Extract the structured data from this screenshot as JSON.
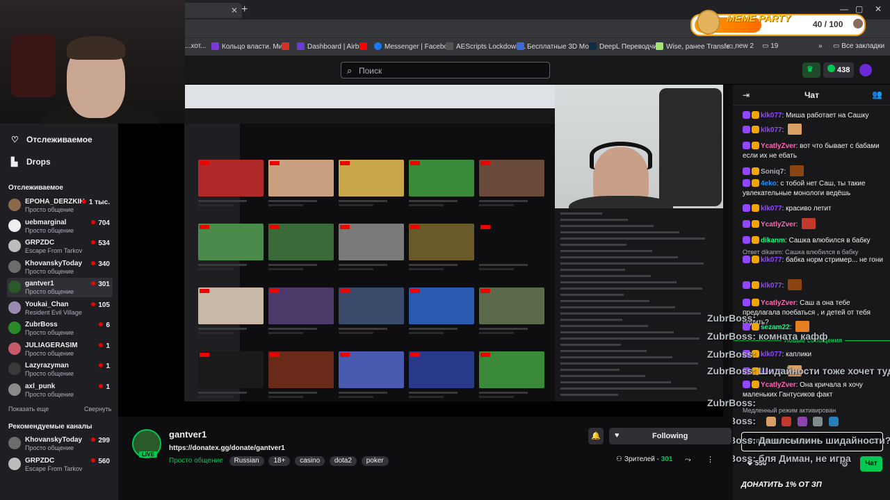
{
  "browser": {
    "tabs": [
      {
        "label": "...",
        "active": true
      }
    ],
    "bookmarks": [
      {
        "label": "...хот..."
      },
      {
        "label": "Кольцо власти. Ми..."
      },
      {
        "label": "Dashboard | Airbit"
      },
      {
        "label": "Messenger | Facebo..."
      },
      {
        "label": "AEScripts Lockdown..."
      },
      {
        "label": "Бесплатные 3D Мо..."
      },
      {
        "label": "DeepL Переводчик"
      },
      {
        "label": "Wise, ранее Transfe..."
      },
      {
        "label": "new 2"
      },
      {
        "label": "19"
      },
      {
        "label": "Все закладки"
      }
    ]
  },
  "overlay": {
    "title": "MEME PARTY",
    "count": "40 / 100"
  },
  "topnav": {
    "search_placeholder": "Поиск",
    "points": "438"
  },
  "sidebar": {
    "nav": [
      {
        "label": "Отслеживаемое",
        "icon": "heart-icon"
      },
      {
        "label": "Drops",
        "icon": "drops-icon"
      }
    ],
    "followed_title": "Отслеживаемое",
    "followed": [
      {
        "name": "EPOHA_DERZKIH",
        "game": "Просто общение",
        "viewers": "1 тыс.",
        "color": "#8a6a4a"
      },
      {
        "name": "uebmarginal",
        "game": "Просто общение",
        "viewers": "704",
        "color": "#eeeeee"
      },
      {
        "name": "GRPZDC",
        "game": "Escape From Tarkov",
        "viewers": "534",
        "color": "#bcbcbc"
      },
      {
        "name": "KhovanskyToday",
        "game": "Просто общение",
        "viewers": "340",
        "color": "#6c6c6c"
      },
      {
        "name": "gantver1",
        "game": "Просто общение",
        "viewers": "301",
        "color": "#2a5a2a"
      },
      {
        "name": "Youkai_Chan",
        "game": "Resident Evil Village",
        "viewers": "105",
        "color": "#9a8ab0"
      },
      {
        "name": "ZubrBoss",
        "game": "Просто общение",
        "viewers": "6",
        "color": "#2a8a2a"
      },
      {
        "name": "JULIAGERASIM",
        "game": "Просто общение",
        "viewers": "1",
        "color": "#c45a6a"
      },
      {
        "name": "Lazyrazyman",
        "game": "Просто общение",
        "viewers": "1",
        "color": "#3a3a3a"
      },
      {
        "name": "axl_punk",
        "game": "Просто общение",
        "viewers": "1",
        "color": "#8a8a8a"
      }
    ],
    "show_more": "Показать еще",
    "collapse": "Свернуть",
    "recommended_title": "Рекомендуемые каналы",
    "recommended": [
      {
        "name": "KhovanskyToday",
        "game": "Просто общение",
        "viewers": "299",
        "color": "#6c6c6c"
      },
      {
        "name": "GRPZDC",
        "game": "Escape From Tarkov",
        "viewers": "560",
        "color": "#bcbcbc"
      }
    ]
  },
  "stream": {
    "channel": "gantver1",
    "live": "LIVE",
    "title": "https://donatex.gg/donate/gantver1",
    "category": "Просто общение",
    "tags": [
      "Russian",
      "18+",
      "casino",
      "dota2",
      "poker"
    ],
    "following_label": "Following",
    "viewers_label": "Зрителей -",
    "viewers": "301"
  },
  "chat": {
    "title": "Чат",
    "messages": [
      {
        "user": "klk077",
        "color": "#9147ff",
        "text": "Миша работает на Сашку",
        "emote": false
      },
      {
        "user": "klk077",
        "color": "#9147ff",
        "text": "",
        "emote": true
      },
      {
        "user": "YcatlyZver",
        "color": "#ff69b4",
        "text": "вот что бывает с бабами если их не ебать",
        "emote": false
      },
      {
        "user": "Soniq7",
        "color": "#adadb8",
        "text": "",
        "emote": true
      },
      {
        "user": "4eko",
        "color": "#1e90ff",
        "text": "с тобой нет Саш, ты такие увлекательные монологи ведёшь",
        "emote": false
      },
      {
        "user": "klk077",
        "color": "#9147ff",
        "text": "красиво летит",
        "emote": false
      },
      {
        "user": "YcatlyZver",
        "color": "#ff69b4",
        "text": "",
        "emote": true
      },
      {
        "user": "dikanm",
        "color": "#00ff7f",
        "text": "Сашка влюбился в бабку",
        "emote": false
      },
      {
        "user": "klk077",
        "color": "#9147ff",
        "text": "бабка норм стример... не гони",
        "emote": false
      },
      {
        "user": "klk077",
        "color": "#9147ff",
        "text": "",
        "emote": true
      },
      {
        "user": "YcatlyZver",
        "color": "#ff69b4",
        "text": "Саш а она тебе предлагала поебаться , и детей от тебя родить?",
        "emote": false
      },
      {
        "user": "sezam22",
        "color": "#00ff7f",
        "text": "",
        "emote": true
      },
      {
        "user": "klk077",
        "color": "#9147ff",
        "text": "каплики",
        "emote": false
      },
      {
        "user": "klk077",
        "color": "#9147ff",
        "text": "",
        "emote": true
      },
      {
        "user": "YcatlyZver",
        "color": "#ff69b4",
        "text": "Она кричала я хочу маленьких Гантусиков факт",
        "emote": false
      }
    ],
    "reply_text": "Ответ dikanm: Сашка влюбился в бабку",
    "new_messages": "Новые сообщения",
    "slow_mode": "Медленный режим активирован",
    "input_placeholder": "Отправить сообщение",
    "points": "550",
    "send_label": "Чат",
    "tts": [
      "ZubrBoss:",
      "ZubrBoss: комната кафф",
      "ZubrBoss:",
      "ZubrBoss: Шидайности тоже хочет туда",
      "ZubrBoss:",
      "ZubrBoss:",
      "ZubrBoss: Дашлсылинь шидайности?",
      "ZubrBoss: бля Диман, не игра"
    ],
    "donate_banner": "ДОНАТИТЬ 1% ОТ ЗП"
  }
}
